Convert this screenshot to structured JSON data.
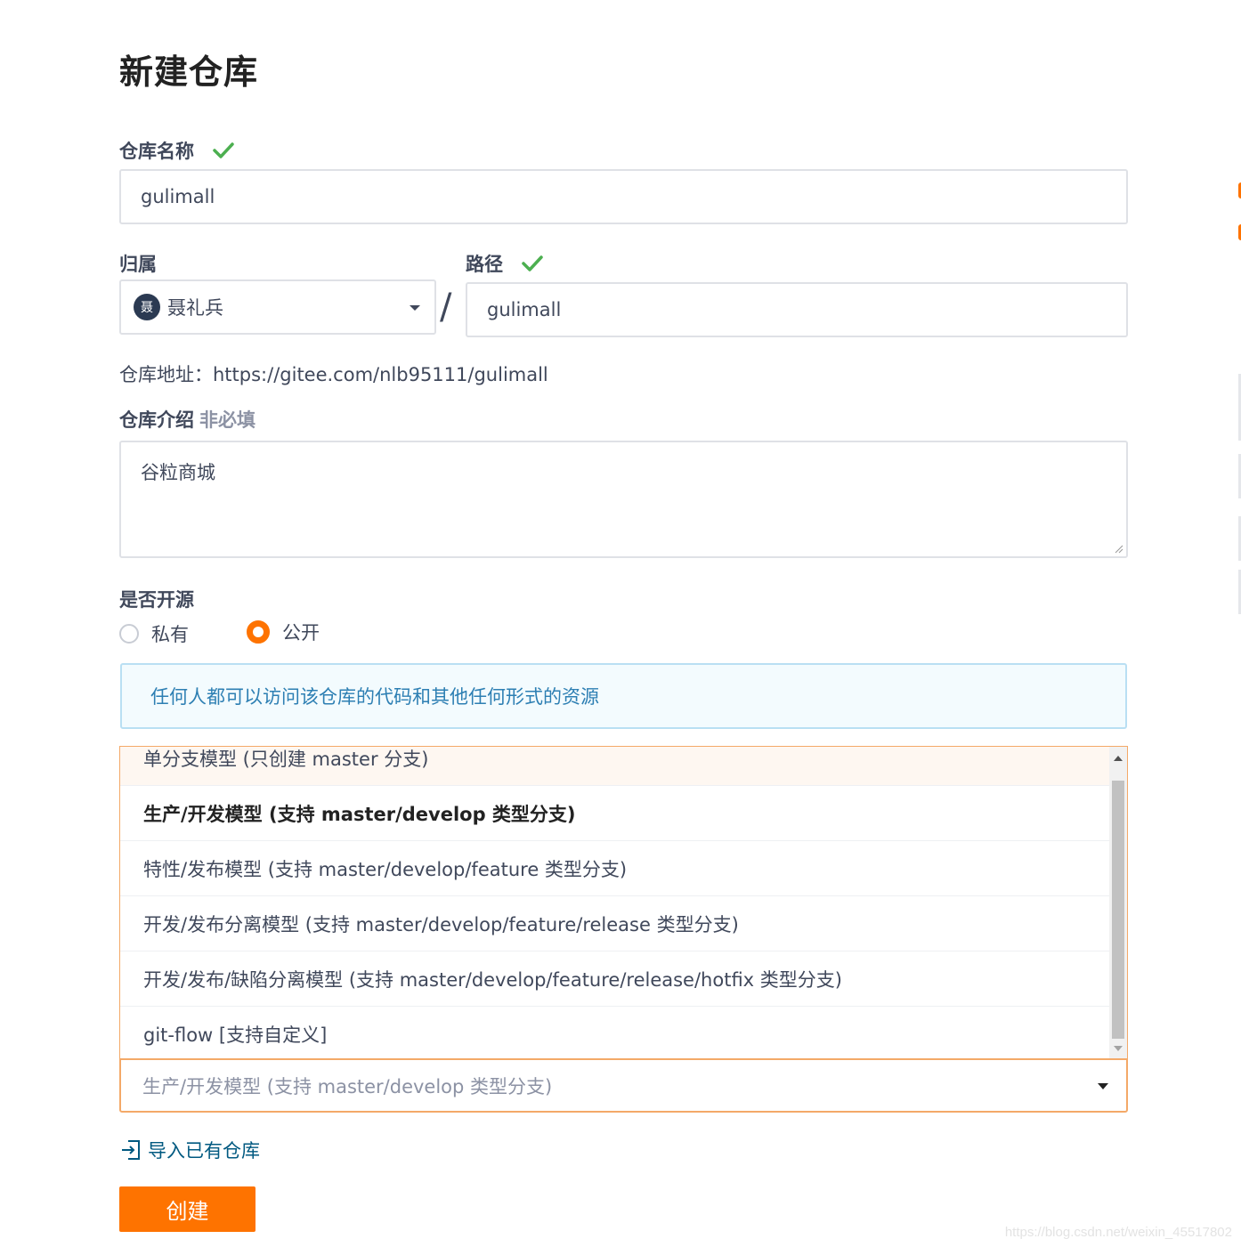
{
  "page": {
    "title": "新建仓库"
  },
  "repo_name": {
    "label": "仓库名称",
    "value": "gulimall"
  },
  "owner": {
    "label": "归属",
    "avatar_text": "聂",
    "value": "聂礼兵"
  },
  "path": {
    "label": "路径",
    "separator": "/",
    "value": "gulimall"
  },
  "repo_url": {
    "text": "仓库地址：https://gitee.com/nlb95111/gulimall"
  },
  "description": {
    "label": "仓库介绍",
    "optional_label": "非必填",
    "value": "谷粒商城"
  },
  "visibility": {
    "label": "是否开源",
    "options": [
      {
        "label": "私有",
        "checked": false
      },
      {
        "label": "公开",
        "checked": true
      }
    ],
    "info": "任何人都可以访问该仓库的代码和其他任何形式的资源"
  },
  "branch_model": {
    "options": [
      "单分支模型 (只创建 master 分支)",
      "生产/开发模型 (支持 master/develop 类型分支)",
      "特性/发布模型 (支持 master/develop/feature 类型分支)",
      "开发/发布分离模型 (支持 master/develop/feature/release 类型分支)",
      "开发/发布/缺陷分离模型 (支持 master/develop/feature/release/hotfix 类型分支)",
      "git-flow [支持自定义]"
    ],
    "hovered_index": 0,
    "selected_index": 1,
    "selected_value": "生产/开发模型 (支持 master/develop 类型分支)"
  },
  "import_link": {
    "label": "导入已有仓库"
  },
  "create_button": {
    "label": "创建"
  },
  "watermark": {
    "text": "https://blog.csdn.net/weixin_45517802"
  },
  "colors": {
    "accent": "#fe7300",
    "success": "#4caf50",
    "info_text": "#2d7fb3",
    "link": "#005980"
  }
}
